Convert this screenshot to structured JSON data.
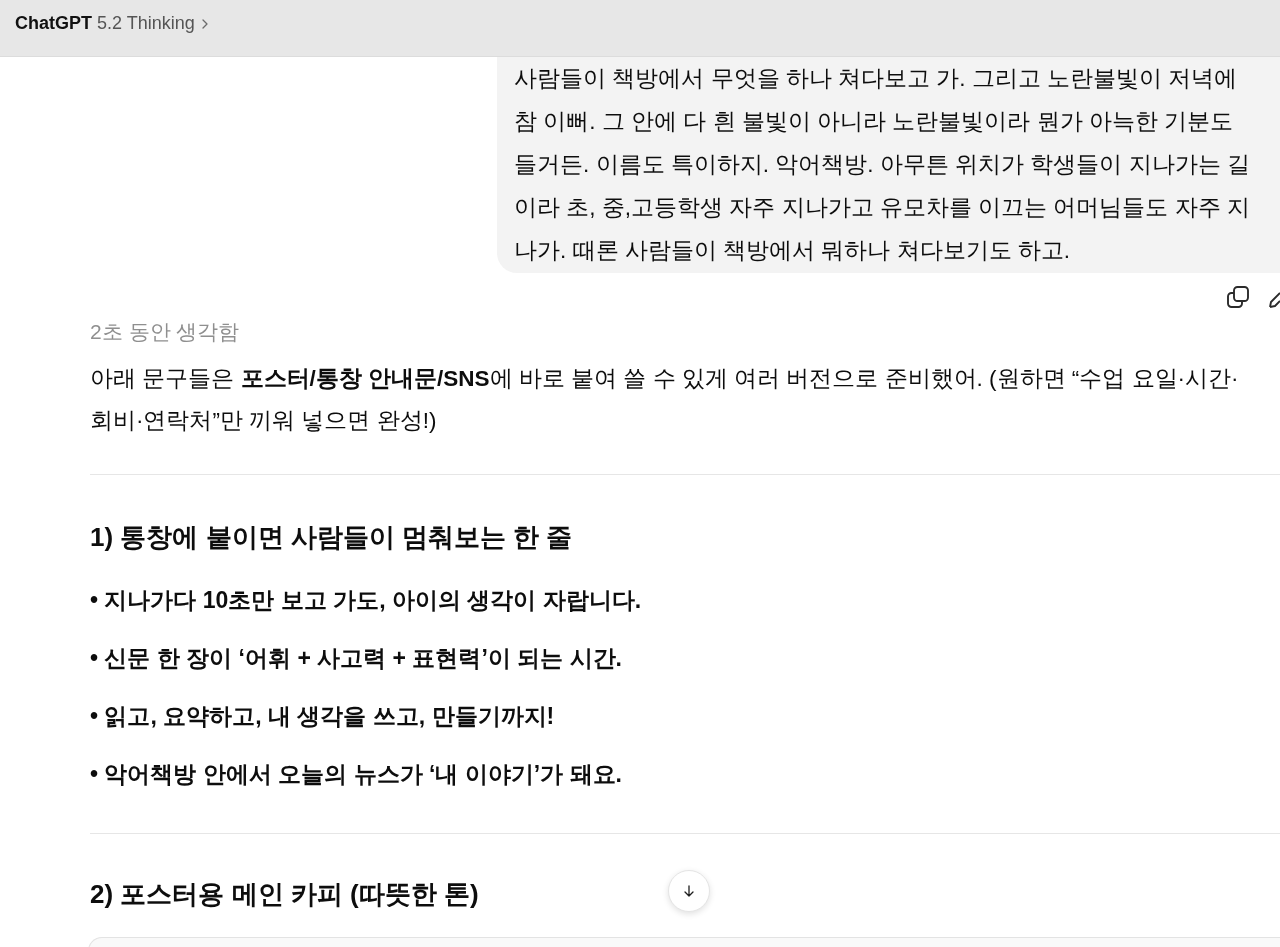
{
  "header": {
    "brand": "ChatGPT",
    "model": "5.2 Thinking"
  },
  "user_message": {
    "text": "사람들이 책방에서 무엇을 하나 쳐다보고 가. 그리고 노란불빛이 저녁에 참 이뻐. 그 안에 다 흰 불빛이 아니라 노란불빛이라 뭔가 아늑한 기분도 들거든. 이름도 특이하지. 악어책방. 아무튼 위치가 학생들이 지나가는 길이라 초, 중,고등학생 자주 지나가고 유모차를 이끄는 어머님들도 자주 지나가. 때론 사람들이 책방에서 뭐하나 쳐다보기도 하고."
  },
  "assistant": {
    "thought_label": "2초 동안 생각함",
    "intro": "아래 문구들은 **포스터/통창 안내문/SNS**에 바로 붙여 쓸 수 있게 여러 버전으로 준비했어. (원하면 “수업 요일·시간·회비·연락처”만 끼워 넣으면 완성!)",
    "sections": [
      {
        "heading": "1) 통창에 붙이면 사람들이 멈춰보는 한 줄",
        "bullets": [
          "• 지나가다 10초만 보고 가도, 아이의 생각이 자랍니다.",
          "• 신문 한 장이 ‘어휘 + 사고력 + 표현력’이 되는 시간.",
          "• 읽고, 요약하고, 내 생각을 쓰고, 만들기까지!",
          "• 악어책방 안에서 오늘의 뉴스가 ‘내 이야기’가 돼요."
        ]
      },
      {
        "heading": "2) 포스터용 메인 카피 (따뜻한 톤)"
      }
    ]
  }
}
